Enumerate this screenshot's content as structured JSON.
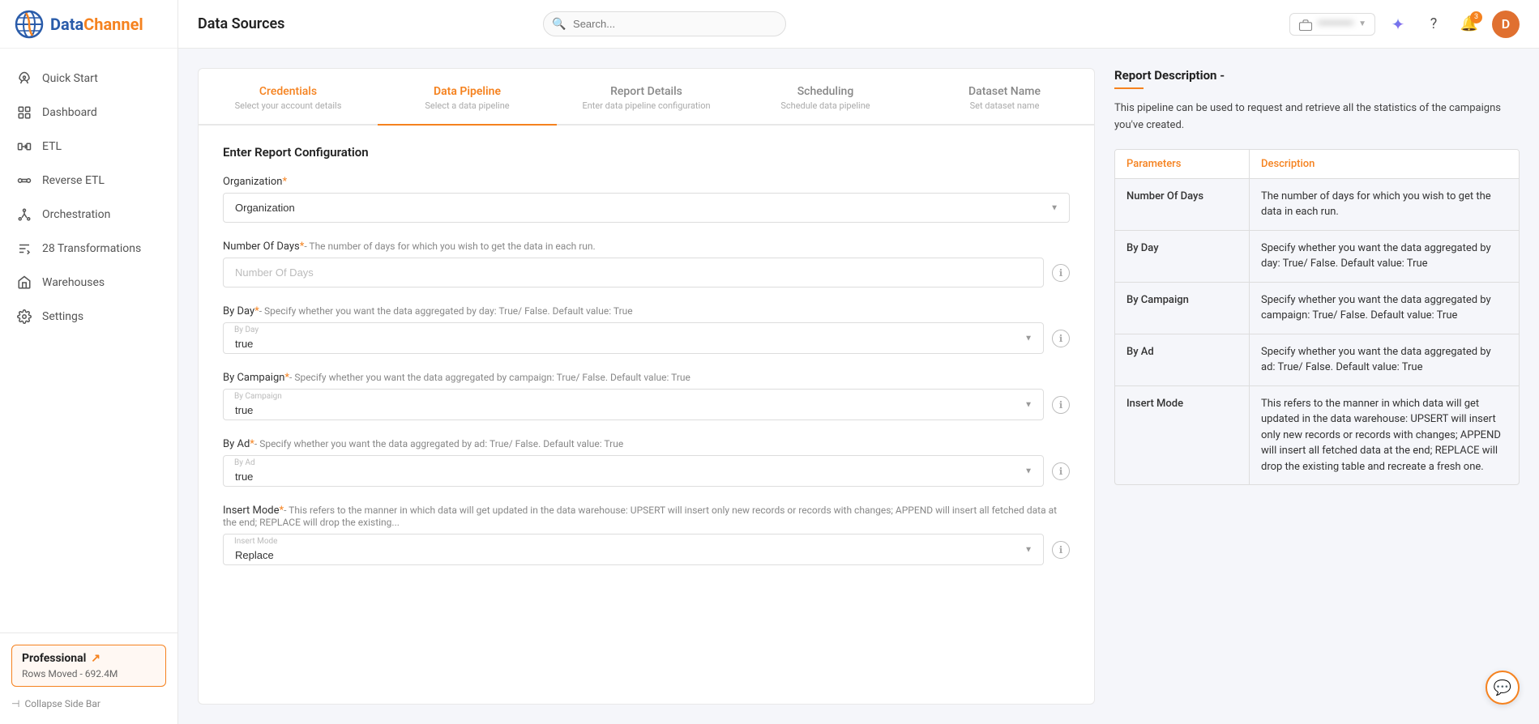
{
  "sidebar": {
    "logo": {
      "data": "Data",
      "channel": "Channel"
    },
    "items": [
      {
        "id": "quick-start",
        "label": "Quick Start",
        "icon": "rocket"
      },
      {
        "id": "dashboard",
        "label": "Dashboard",
        "icon": "dashboard"
      },
      {
        "id": "etl",
        "label": "ETL",
        "icon": "etl"
      },
      {
        "id": "reverse-etl",
        "label": "Reverse ETL",
        "icon": "reverse-etl"
      },
      {
        "id": "orchestration",
        "label": "Orchestration",
        "icon": "orchestration"
      },
      {
        "id": "transformations",
        "label": "28 Transformations",
        "icon": "transformations"
      },
      {
        "id": "warehouses",
        "label": "Warehouses",
        "icon": "warehouses"
      },
      {
        "id": "settings",
        "label": "Settings",
        "icon": "settings"
      }
    ],
    "plan": {
      "label": "Professional",
      "rows": "Rows Moved - 692.4M"
    },
    "collapse_label": "Collapse Side Bar"
  },
  "header": {
    "title": "Data Sources",
    "search_placeholder": "Search...",
    "account_blurred": "••••••••••",
    "avatar_letter": "D",
    "notification_count": "3"
  },
  "wizard": {
    "steps": [
      {
        "id": "credentials",
        "title": "Credentials",
        "subtitle": "Select your account details",
        "active": false
      },
      {
        "id": "data-pipeline",
        "title": "Data Pipeline",
        "subtitle": "Select a data pipeline",
        "active": true
      },
      {
        "id": "report-details",
        "title": "Report Details",
        "subtitle": "Enter data pipeline configuration",
        "active": false
      },
      {
        "id": "scheduling",
        "title": "Scheduling",
        "subtitle": "Schedule data pipeline",
        "active": false
      },
      {
        "id": "dataset-name",
        "title": "Dataset Name",
        "subtitle": "Set dataset name",
        "active": false
      }
    ]
  },
  "form": {
    "section_title": "Enter Report Configuration",
    "fields": [
      {
        "id": "organization",
        "label": "Organization",
        "required": true,
        "type": "select",
        "placeholder": "Organization",
        "hint": ""
      },
      {
        "id": "number-of-days",
        "label": "Number Of Days",
        "required": true,
        "type": "input",
        "placeholder": "Number Of Days",
        "hint": "- The number of days for which you wish to get the data in each run."
      },
      {
        "id": "by-day",
        "label": "By Day",
        "required": true,
        "type": "select",
        "floating_label": "By Day",
        "value": "true",
        "hint": "- Specify whether you want the data aggregated by day: True/ False. Default value: True"
      },
      {
        "id": "by-campaign",
        "label": "By Campaign",
        "required": true,
        "type": "select",
        "floating_label": "By Campaign",
        "value": "true",
        "hint": "- Specify whether you want the data aggregated by campaign: True/ False. Default value: True"
      },
      {
        "id": "by-ad",
        "label": "By Ad",
        "required": true,
        "type": "select",
        "floating_label": "By Ad",
        "value": "true",
        "hint": "- Specify whether you want the data aggregated by ad: True/ False. Default value: True"
      },
      {
        "id": "insert-mode",
        "label": "Insert Mode",
        "required": true,
        "type": "select",
        "floating_label": "Insert Mode",
        "value": "Replace",
        "hint": "- This refers to the manner in which data will get updated in the data warehouse: UPSERT will insert only new records or records with changes; APPEND will insert all fetched data at the end; REPLACE will drop the existing..."
      }
    ]
  },
  "description": {
    "title": "Report Description -",
    "text": "This pipeline can be used to request and retrieve all the statistics of the campaigns you've created.",
    "table": {
      "headers": [
        "Parameters",
        "Description"
      ],
      "rows": [
        {
          "parameter": "Number Of Days",
          "description": "The number of days for which you wish to get the data in each run."
        },
        {
          "parameter": "By Day",
          "description": "Specify whether you want the data aggregated by day: True/ False. Default value: True"
        },
        {
          "parameter": "By Campaign",
          "description": "Specify whether you want the data aggregated by campaign: True/ False. Default value: True"
        },
        {
          "parameter": "By Ad",
          "description": "Specify whether you want the data aggregated by ad: True/ False. Default value: True"
        },
        {
          "parameter": "Insert Mode",
          "description": "This refers to the manner in which data will get updated in the data warehouse: UPSERT will insert only new records or records with changes; APPEND will insert all fetched data at the end; REPLACE will drop the existing table and recreate a fresh one."
        }
      ]
    }
  },
  "colors": {
    "accent": "#f5821f",
    "brand_blue": "#2a5caa",
    "active_nav": "#f5821f"
  }
}
